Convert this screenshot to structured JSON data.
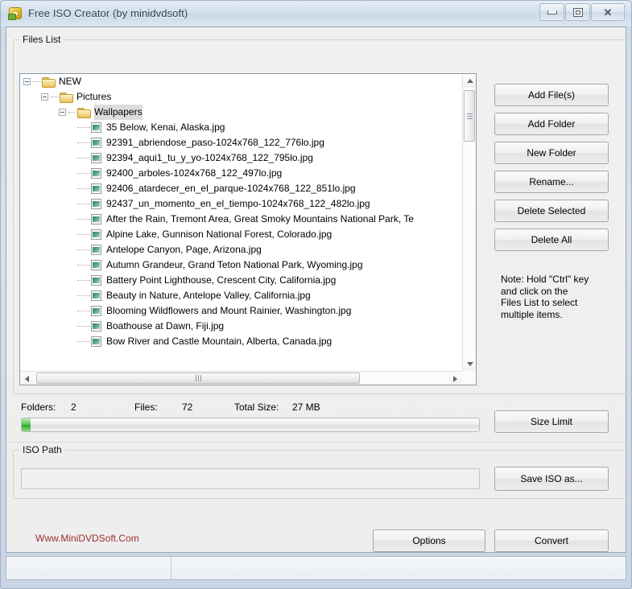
{
  "window": {
    "title": "Free ISO Creator (by minidvdsoft)",
    "icon": "disc-icon",
    "controls": {
      "minimize": "minimize-icon",
      "maximize": "maximize-icon",
      "close": "✕"
    }
  },
  "files_list": {
    "group_label": "Files List",
    "tree": [
      {
        "depth": 0,
        "type": "folder",
        "label": "NEW",
        "expanded": true,
        "selected": false
      },
      {
        "depth": 1,
        "type": "folder",
        "label": "Pictures",
        "expanded": true,
        "selected": false
      },
      {
        "depth": 2,
        "type": "folder",
        "label": "Wallpapers",
        "expanded": true,
        "selected": true
      },
      {
        "depth": 3,
        "type": "file",
        "label": "35 Below, Kenai, Alaska.jpg",
        "expanded": false,
        "selected": false
      },
      {
        "depth": 3,
        "type": "file",
        "label": "92391_abriendose_paso-1024x768_122_776lo.jpg",
        "expanded": false,
        "selected": false
      },
      {
        "depth": 3,
        "type": "file",
        "label": "92394_aqui1_tu_y_yo-1024x768_122_795lo.jpg",
        "expanded": false,
        "selected": false
      },
      {
        "depth": 3,
        "type": "file",
        "label": "92400_arboles-1024x768_122_497lo.jpg",
        "expanded": false,
        "selected": false
      },
      {
        "depth": 3,
        "type": "file",
        "label": "92406_atardecer_en_el_parque-1024x768_122_851lo.jpg",
        "expanded": false,
        "selected": false
      },
      {
        "depth": 3,
        "type": "file",
        "label": "92437_un_momento_en_el_tiempo-1024x768_122_482lo.jpg",
        "expanded": false,
        "selected": false
      },
      {
        "depth": 3,
        "type": "file",
        "label": "After the Rain, Tremont Area, Great Smoky Mountains National Park, Te",
        "expanded": false,
        "selected": false
      },
      {
        "depth": 3,
        "type": "file",
        "label": "Alpine Lake, Gunnison National Forest, Colorado.jpg",
        "expanded": false,
        "selected": false
      },
      {
        "depth": 3,
        "type": "file",
        "label": "Antelope Canyon, Page, Arizona.jpg",
        "expanded": false,
        "selected": false
      },
      {
        "depth": 3,
        "type": "file",
        "label": "Autumn Grandeur, Grand Teton National Park, Wyoming.jpg",
        "expanded": false,
        "selected": false
      },
      {
        "depth": 3,
        "type": "file",
        "label": "Battery Point Lighthouse, Crescent City, California.jpg",
        "expanded": false,
        "selected": false
      },
      {
        "depth": 3,
        "type": "file",
        "label": "Beauty in Nature, Antelope Valley, California.jpg",
        "expanded": false,
        "selected": false
      },
      {
        "depth": 3,
        "type": "file",
        "label": "Blooming Wildflowers and Mount Rainier, Washington.jpg",
        "expanded": false,
        "selected": false
      },
      {
        "depth": 3,
        "type": "file",
        "label": "Boathouse at Dawn, Fiji.jpg",
        "expanded": false,
        "selected": false
      },
      {
        "depth": 3,
        "type": "file",
        "label": "Bow River and Castle Mountain, Alberta, Canada.jpg",
        "expanded": false,
        "selected": false
      }
    ]
  },
  "side_buttons": [
    {
      "label": "Add File(s)"
    },
    {
      "label": "Add Folder"
    },
    {
      "label": "New Folder"
    },
    {
      "label": "Rename..."
    },
    {
      "label": "Delete Selected"
    },
    {
      "label": "Delete All"
    }
  ],
  "note": "Note: Hold \"Ctrl\" key and click on the Files List to select multiple items.",
  "info": {
    "folders_label": "Folders:",
    "folders_value": "2",
    "files_label": "Files:",
    "files_value": "72",
    "total_size_label": "Total Size:",
    "total_size_value": "27 MB",
    "progress_percent": 2
  },
  "size_limit_button": "Size Limit",
  "iso_path": {
    "group_label": "ISO Path",
    "value": "",
    "placeholder": ""
  },
  "save_iso_button": "Save ISO as...",
  "site_link": "Www.MiniDVDSoft.Com",
  "options_button": "Options",
  "convert_button": "Convert",
  "status_bar": {
    "pane1": "",
    "pane2": ""
  },
  "colors": {
    "link": "#9a2f2b",
    "progress_fill": "#38a533",
    "folder": "#e7c158",
    "selection": "#dcdcdc"
  }
}
